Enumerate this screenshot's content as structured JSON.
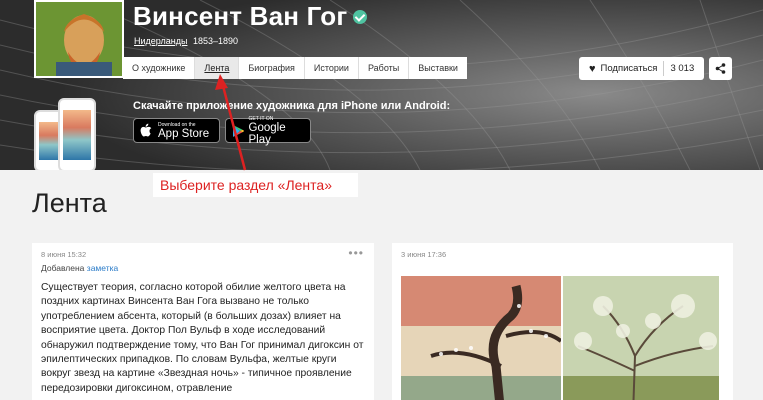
{
  "artist": {
    "name": "Винсент Ван Гог",
    "country": "Нидерланды",
    "years": "1853–1890"
  },
  "tabs": [
    {
      "label": "О художнике",
      "active": false
    },
    {
      "label": "Лента",
      "active": true
    },
    {
      "label": "Биография",
      "active": false
    },
    {
      "label": "Истории",
      "active": false
    },
    {
      "label": "Работы",
      "active": false
    },
    {
      "label": "Выставки",
      "active": false
    }
  ],
  "subscribe": {
    "label": "Подписаться",
    "count": "3 013"
  },
  "app": {
    "cta": "Скачайте приложение художника для iPhone или Android:",
    "appstore_small": "Download on the",
    "appstore_big": "App Store",
    "googleplay_small": "GET IT ON",
    "googleplay_big": "Google Play"
  },
  "annotation": "Выберите раздел «Лента»",
  "page_title": "Лента",
  "posts": [
    {
      "timestamp": "8 июня 15:32",
      "added_prefix": "Добавлена",
      "added_link": "заметка",
      "text": "Существует теория, согласно которой обилие желтого цвета на поздних картинах Винсента Ван Гога вызвано не только употреблением абсента, который (в больших дозах) влияет на восприятие цвета. Доктор Пол Вульф в ходе исследований обнаружил подтверждение тому, что Ван Гог принимал дигоксин от эпилептических припадков. По словам Вульфа, желтые круги вокруг звезд на картине «Звездная ночь» - типичное проявление передозировки дигоксином, отравление"
    },
    {
      "timestamp": "3 июня 17:36"
    }
  ],
  "colors": {
    "accent_link": "#2a7bc8",
    "annotation": "#d22222",
    "verified": "#4fc3a1"
  }
}
